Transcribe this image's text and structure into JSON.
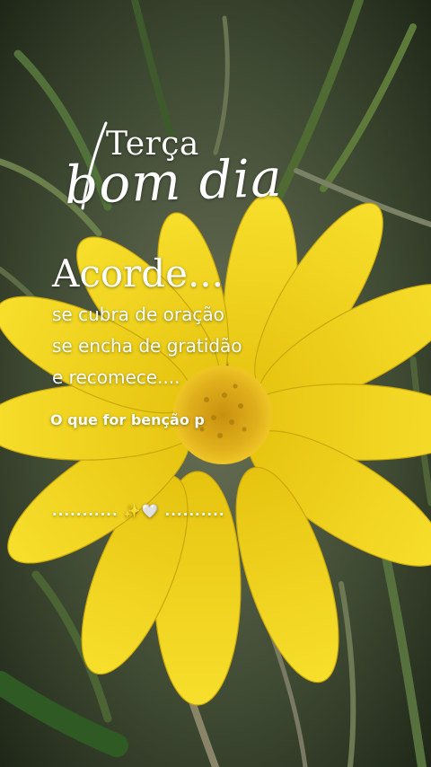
{
  "title": {
    "day": "Terça",
    "greeting": "bom dia"
  },
  "message": {
    "headline": "Acorde...",
    "lines": [
      "se cubra de oração",
      "se encha de gratidão",
      "e recomece...."
    ]
  },
  "caption": "O que for benção p",
  "footer": {
    "left_dots": "...........",
    "emoji_sparkles": "✨",
    "emoji_heart": "🤍",
    "right_dots": ".........."
  },
  "colors": {
    "petal": "#f2d21e",
    "center": "#d9a91c",
    "grass": "#3f5a2a",
    "text": "#ffffff"
  }
}
